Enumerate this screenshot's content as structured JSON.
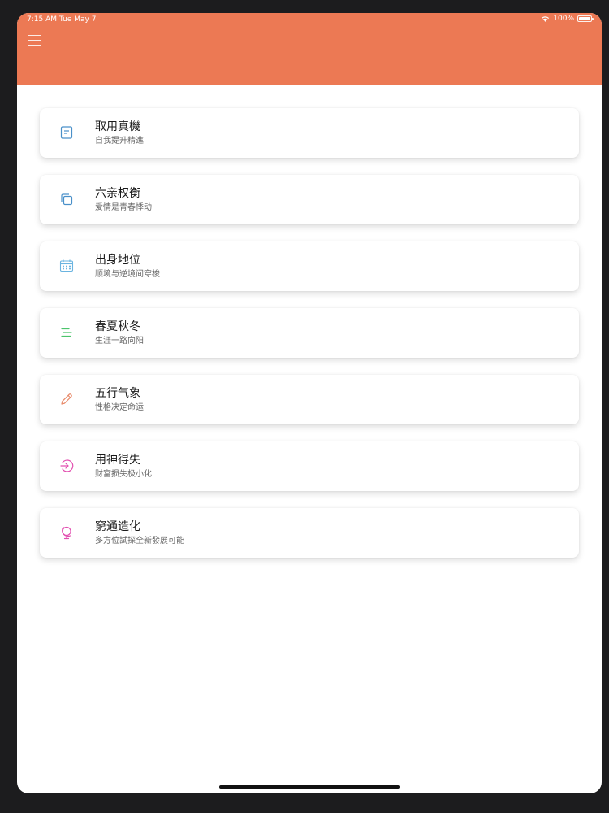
{
  "status_bar": {
    "time": "7:15 AM",
    "date": "Tue May 7",
    "battery": "100%"
  },
  "header": {
    "menu_icon": "hamburger-menu-icon",
    "color": "#ec7954"
  },
  "items": [
    {
      "title": "取用真機",
      "subtitle": "自我提升精進",
      "icon": "document-icon",
      "icon_color": "#4a90c9"
    },
    {
      "title": "六亲权衡",
      "subtitle": "爱情是青春悸动",
      "icon": "copy-icon",
      "icon_color": "#4a90c9"
    },
    {
      "title": "出身地位",
      "subtitle": "顺境与逆境间穿梭",
      "icon": "calendar-icon",
      "icon_color": "#6ab4e0"
    },
    {
      "title": "春夏秋冬",
      "subtitle": "生涯一路向阳",
      "icon": "lines-icon",
      "icon_color": "#4cc46c"
    },
    {
      "title": "五行气象",
      "subtitle": "性格决定命运",
      "icon": "pencil-icon",
      "icon_color": "#e88a6a"
    },
    {
      "title": "用神得失",
      "subtitle": "财富损失极小化",
      "icon": "login-icon",
      "icon_color": "#e24fb0"
    },
    {
      "title": "窮通造化",
      "subtitle": "多方位試探全新發展可能",
      "icon": "globe-icon",
      "icon_color": "#e24fb0"
    }
  ]
}
